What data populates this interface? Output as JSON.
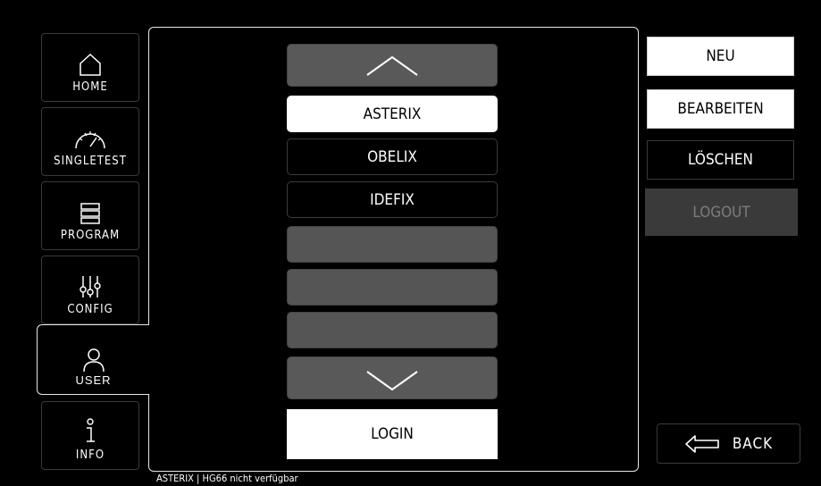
{
  "sidebar": {
    "items": [
      {
        "label": "HOME",
        "icon": "home-icon"
      },
      {
        "label": "SINGLETEST",
        "icon": "gauge-icon"
      },
      {
        "label": "PROGRAM",
        "icon": "list-icon"
      },
      {
        "label": "CONFIG",
        "icon": "sliders-icon"
      },
      {
        "label": "USER",
        "icon": "user-icon",
        "active": true
      },
      {
        "label": "INFO",
        "icon": "info-icon"
      }
    ]
  },
  "user_list": {
    "items": [
      "ASTERIX",
      "OBELIX",
      "IDEFIX",
      "",
      "",
      ""
    ],
    "selected": "ASTERIX",
    "scroll_up_icon": "chevron-up-icon",
    "scroll_down_icon": "chevron-down-icon"
  },
  "login_label": "LOGIN",
  "actions": {
    "new_label": "NEU",
    "edit_label": "BEARBEITEN",
    "delete_label": "LÖSCHEN",
    "logout_label": "LOGOUT"
  },
  "back_label": "BACK",
  "status_text": "ASTERIX | HG66 nicht verfügbar",
  "colors": {
    "background": "#000000",
    "selected": "#ffffff",
    "disabled": "#3a3a3a",
    "empty_slot": "#555555"
  }
}
